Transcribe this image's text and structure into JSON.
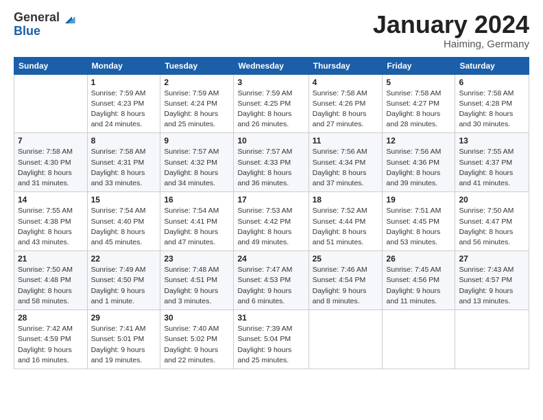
{
  "logo": {
    "general": "General",
    "blue": "Blue"
  },
  "header": {
    "month": "January 2024",
    "location": "Haiming, Germany"
  },
  "weekdays": [
    "Sunday",
    "Monday",
    "Tuesday",
    "Wednesday",
    "Thursday",
    "Friday",
    "Saturday"
  ],
  "weeks": [
    [
      {
        "day": "",
        "sunrise": "",
        "sunset": "",
        "daylight": ""
      },
      {
        "day": "1",
        "sunrise": "Sunrise: 7:59 AM",
        "sunset": "Sunset: 4:23 PM",
        "daylight": "Daylight: 8 hours and 24 minutes."
      },
      {
        "day": "2",
        "sunrise": "Sunrise: 7:59 AM",
        "sunset": "Sunset: 4:24 PM",
        "daylight": "Daylight: 8 hours and 25 minutes."
      },
      {
        "day": "3",
        "sunrise": "Sunrise: 7:59 AM",
        "sunset": "Sunset: 4:25 PM",
        "daylight": "Daylight: 8 hours and 26 minutes."
      },
      {
        "day": "4",
        "sunrise": "Sunrise: 7:58 AM",
        "sunset": "Sunset: 4:26 PM",
        "daylight": "Daylight: 8 hours and 27 minutes."
      },
      {
        "day": "5",
        "sunrise": "Sunrise: 7:58 AM",
        "sunset": "Sunset: 4:27 PM",
        "daylight": "Daylight: 8 hours and 28 minutes."
      },
      {
        "day": "6",
        "sunrise": "Sunrise: 7:58 AM",
        "sunset": "Sunset: 4:28 PM",
        "daylight": "Daylight: 8 hours and 30 minutes."
      }
    ],
    [
      {
        "day": "7",
        "sunrise": "Sunrise: 7:58 AM",
        "sunset": "Sunset: 4:30 PM",
        "daylight": "Daylight: 8 hours and 31 minutes."
      },
      {
        "day": "8",
        "sunrise": "Sunrise: 7:58 AM",
        "sunset": "Sunset: 4:31 PM",
        "daylight": "Daylight: 8 hours and 33 minutes."
      },
      {
        "day": "9",
        "sunrise": "Sunrise: 7:57 AM",
        "sunset": "Sunset: 4:32 PM",
        "daylight": "Daylight: 8 hours and 34 minutes."
      },
      {
        "day": "10",
        "sunrise": "Sunrise: 7:57 AM",
        "sunset": "Sunset: 4:33 PM",
        "daylight": "Daylight: 8 hours and 36 minutes."
      },
      {
        "day": "11",
        "sunrise": "Sunrise: 7:56 AM",
        "sunset": "Sunset: 4:34 PM",
        "daylight": "Daylight: 8 hours and 37 minutes."
      },
      {
        "day": "12",
        "sunrise": "Sunrise: 7:56 AM",
        "sunset": "Sunset: 4:36 PM",
        "daylight": "Daylight: 8 hours and 39 minutes."
      },
      {
        "day": "13",
        "sunrise": "Sunrise: 7:55 AM",
        "sunset": "Sunset: 4:37 PM",
        "daylight": "Daylight: 8 hours and 41 minutes."
      }
    ],
    [
      {
        "day": "14",
        "sunrise": "Sunrise: 7:55 AM",
        "sunset": "Sunset: 4:38 PM",
        "daylight": "Daylight: 8 hours and 43 minutes."
      },
      {
        "day": "15",
        "sunrise": "Sunrise: 7:54 AM",
        "sunset": "Sunset: 4:40 PM",
        "daylight": "Daylight: 8 hours and 45 minutes."
      },
      {
        "day": "16",
        "sunrise": "Sunrise: 7:54 AM",
        "sunset": "Sunset: 4:41 PM",
        "daylight": "Daylight: 8 hours and 47 minutes."
      },
      {
        "day": "17",
        "sunrise": "Sunrise: 7:53 AM",
        "sunset": "Sunset: 4:42 PM",
        "daylight": "Daylight: 8 hours and 49 minutes."
      },
      {
        "day": "18",
        "sunrise": "Sunrise: 7:52 AM",
        "sunset": "Sunset: 4:44 PM",
        "daylight": "Daylight: 8 hours and 51 minutes."
      },
      {
        "day": "19",
        "sunrise": "Sunrise: 7:51 AM",
        "sunset": "Sunset: 4:45 PM",
        "daylight": "Daylight: 8 hours and 53 minutes."
      },
      {
        "day": "20",
        "sunrise": "Sunrise: 7:50 AM",
        "sunset": "Sunset: 4:47 PM",
        "daylight": "Daylight: 8 hours and 56 minutes."
      }
    ],
    [
      {
        "day": "21",
        "sunrise": "Sunrise: 7:50 AM",
        "sunset": "Sunset: 4:48 PM",
        "daylight": "Daylight: 8 hours and 58 minutes."
      },
      {
        "day": "22",
        "sunrise": "Sunrise: 7:49 AM",
        "sunset": "Sunset: 4:50 PM",
        "daylight": "Daylight: 9 hours and 1 minute."
      },
      {
        "day": "23",
        "sunrise": "Sunrise: 7:48 AM",
        "sunset": "Sunset: 4:51 PM",
        "daylight": "Daylight: 9 hours and 3 minutes."
      },
      {
        "day": "24",
        "sunrise": "Sunrise: 7:47 AM",
        "sunset": "Sunset: 4:53 PM",
        "daylight": "Daylight: 9 hours and 6 minutes."
      },
      {
        "day": "25",
        "sunrise": "Sunrise: 7:46 AM",
        "sunset": "Sunset: 4:54 PM",
        "daylight": "Daylight: 9 hours and 8 minutes."
      },
      {
        "day": "26",
        "sunrise": "Sunrise: 7:45 AM",
        "sunset": "Sunset: 4:56 PM",
        "daylight": "Daylight: 9 hours and 11 minutes."
      },
      {
        "day": "27",
        "sunrise": "Sunrise: 7:43 AM",
        "sunset": "Sunset: 4:57 PM",
        "daylight": "Daylight: 9 hours and 13 minutes."
      }
    ],
    [
      {
        "day": "28",
        "sunrise": "Sunrise: 7:42 AM",
        "sunset": "Sunset: 4:59 PM",
        "daylight": "Daylight: 9 hours and 16 minutes."
      },
      {
        "day": "29",
        "sunrise": "Sunrise: 7:41 AM",
        "sunset": "Sunset: 5:01 PM",
        "daylight": "Daylight: 9 hours and 19 minutes."
      },
      {
        "day": "30",
        "sunrise": "Sunrise: 7:40 AM",
        "sunset": "Sunset: 5:02 PM",
        "daylight": "Daylight: 9 hours and 22 minutes."
      },
      {
        "day": "31",
        "sunrise": "Sunrise: 7:39 AM",
        "sunset": "Sunset: 5:04 PM",
        "daylight": "Daylight: 9 hours and 25 minutes."
      },
      {
        "day": "",
        "sunrise": "",
        "sunset": "",
        "daylight": ""
      },
      {
        "day": "",
        "sunrise": "",
        "sunset": "",
        "daylight": ""
      },
      {
        "day": "",
        "sunrise": "",
        "sunset": "",
        "daylight": ""
      }
    ]
  ]
}
